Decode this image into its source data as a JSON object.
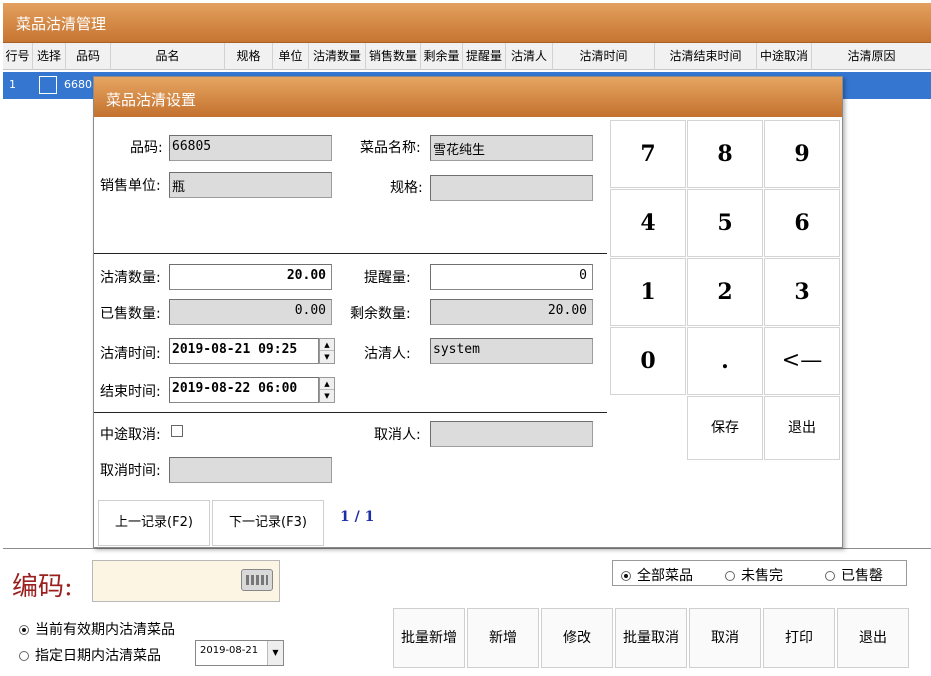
{
  "window": {
    "title": "菜品沽清管理"
  },
  "grid": {
    "columns": [
      {
        "label": "行号"
      },
      {
        "label": "选择"
      },
      {
        "label": "品码"
      },
      {
        "label": "品名"
      },
      {
        "label": "规格"
      },
      {
        "label": "单位"
      },
      {
        "label": "沽清数量"
      },
      {
        "label": "销售数量"
      },
      {
        "label": "剩余量"
      },
      {
        "label": "提醒量"
      },
      {
        "label": "沽清人"
      },
      {
        "label": "沽清时间"
      },
      {
        "label": "沽清结束时间"
      },
      {
        "label": "中途取消"
      },
      {
        "label": "沽清原因"
      }
    ],
    "row": {
      "num": "1",
      "code": "66805"
    }
  },
  "dialog": {
    "title": "菜品沽清设置",
    "code_label": "品码:",
    "code_value": "66805",
    "name_label": "菜品名称:",
    "name_value": "雪花纯生",
    "unit_label": "销售单位:",
    "unit_value": "瓶",
    "spec_label": "规格:",
    "spec_value": "",
    "qty_label": "沽清数量:",
    "qty_value": "20.00",
    "remind_label": "提醒量:",
    "remind_value": "0",
    "sold_label": "已售数量:",
    "sold_value": "0.00",
    "remain_label": "剩余数量:",
    "remain_value": "20.00",
    "time_label": "沽清时间:",
    "time_value": "2019-08-21 09:25",
    "person_label": "沽清人:",
    "person_value": "system",
    "end_label": "结束时间:",
    "end_value": "2019-08-22 06:00",
    "cancel_label": "中途取消:",
    "canceler_label": "取消人:",
    "canceler_value": "",
    "cancel_time_label": "取消时间:",
    "cancel_time_value": "",
    "prev_button": "上一记录(F2)",
    "next_button": "下一记录(F3)",
    "pager": "1 / 1",
    "keypad": [
      "7",
      "8",
      "9",
      "4",
      "5",
      "6",
      "1",
      "2",
      "3",
      "0",
      ".",
      "<—"
    ],
    "save_button": "保存",
    "exit_button": "退出"
  },
  "bottom": {
    "code_label": "编码:",
    "code_value": "",
    "filter_all": "全部菜品",
    "filter_unsold": "未售完",
    "filter_soldout": "已售罄",
    "period_current": "当前有效期内沽清菜品",
    "period_date": "指定日期内沽清菜品",
    "date_value": "2019-08-21",
    "buttons": [
      "批量新增",
      "新增",
      "修改",
      "批量取消",
      "取消",
      "打印",
      "退出"
    ]
  }
}
